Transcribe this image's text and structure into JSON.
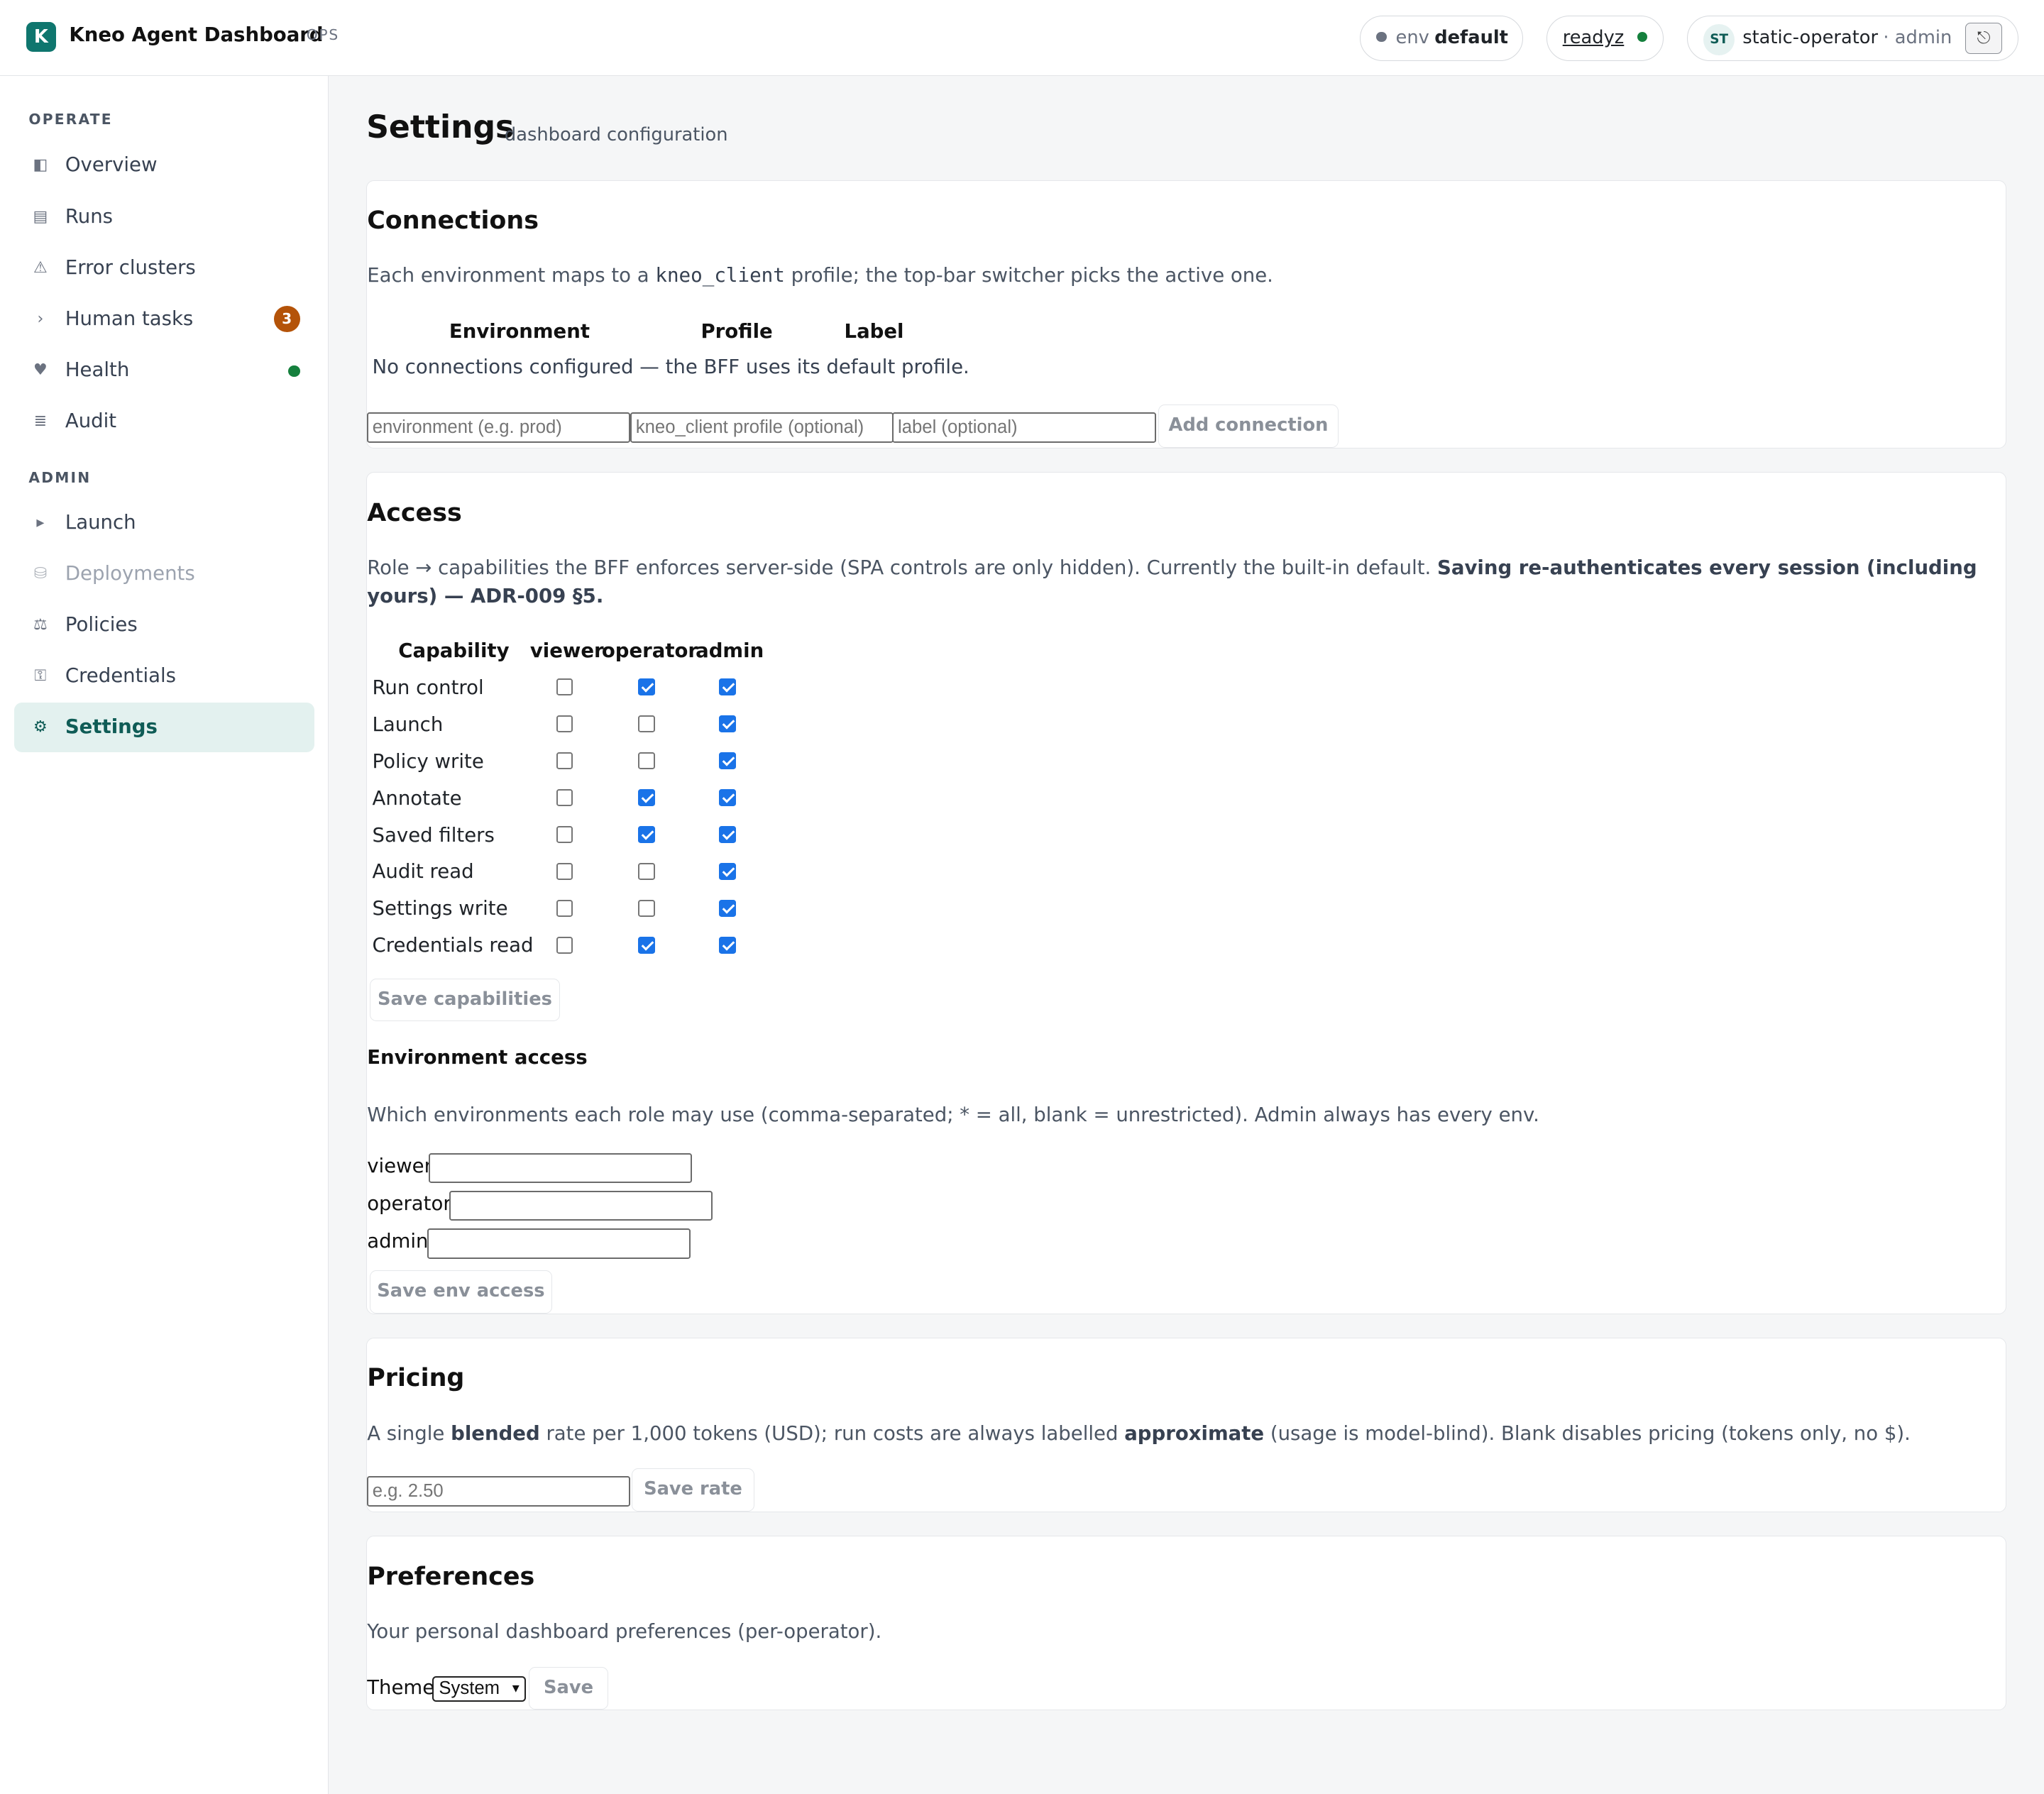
{
  "header": {
    "logo_letter": "K",
    "app_title": "Kneo Agent Dashboard",
    "app_tag": "OPS",
    "env_key": "env",
    "env_value": "default",
    "readyz_label": "readyz",
    "user_initials": "ST",
    "user_name": "static-operator",
    "user_role": "· admin",
    "logout_icon": "⎋"
  },
  "sidebar": {
    "operate_heading": "OPERATE",
    "admin_heading": "ADMIN",
    "operate_items": [
      {
        "label": "Overview",
        "icon": "◧",
        "icon_name": "overview-icon"
      },
      {
        "label": "Runs",
        "icon": "▤",
        "icon_name": "runs-icon"
      },
      {
        "label": "Error clusters",
        "icon": "⚠",
        "icon_name": "warning-icon"
      },
      {
        "label": "Human tasks",
        "icon": "›",
        "icon_name": "chevron-right-icon",
        "badge": "3"
      },
      {
        "label": "Health",
        "icon": "♥",
        "icon_name": "heart-icon",
        "status_color": "#15803d"
      },
      {
        "label": "Audit",
        "icon": "≣",
        "icon_name": "audit-icon"
      }
    ],
    "admin_items": [
      {
        "label": "Launch",
        "icon": "▸",
        "icon_name": "play-icon"
      },
      {
        "label": "Deployments",
        "icon": "⛁",
        "icon_name": "database-icon",
        "disabled": true
      },
      {
        "label": "Policies",
        "icon": "⚖",
        "icon_name": "scales-icon"
      },
      {
        "label": "Credentials",
        "icon": "⚿",
        "icon_name": "key-icon"
      },
      {
        "label": "Settings",
        "icon": "⚙",
        "icon_name": "gear-icon",
        "active": true
      }
    ]
  },
  "page": {
    "title": "Settings",
    "subtitle": "dashboard configuration"
  },
  "connections": {
    "title": "Connections",
    "desc_before": "Each environment maps to a ",
    "desc_code": "kneo_client",
    "desc_after": " profile; the top-bar switcher picks the active one.",
    "columns": [
      "Environment",
      "Profile",
      "Label"
    ],
    "empty_text": "No connections configured — the BFF uses its default profile.",
    "env_placeholder": "environment (e.g. prod)",
    "profile_placeholder": "kneo_client profile (optional)",
    "label_placeholder": "label (optional)",
    "add_button": "Add connection"
  },
  "access": {
    "title": "Access",
    "desc_plain": "Role → capabilities the BFF enforces server-side (SPA controls are only hidden). Currently the built-in default. ",
    "desc_bold": "Saving re-authenticates every session (including yours) — ADR-009 §5.",
    "columns": [
      "Capability",
      "viewer",
      "operator",
      "admin"
    ],
    "capabilities": [
      {
        "name": "Run control",
        "viewer": false,
        "operator": true,
        "admin": true
      },
      {
        "name": "Launch",
        "viewer": false,
        "operator": false,
        "admin": true
      },
      {
        "name": "Policy write",
        "viewer": false,
        "operator": false,
        "admin": true
      },
      {
        "name": "Annotate",
        "viewer": false,
        "operator": true,
        "admin": true
      },
      {
        "name": "Saved filters",
        "viewer": false,
        "operator": true,
        "admin": true
      },
      {
        "name": "Audit read",
        "viewer": false,
        "operator": false,
        "admin": true
      },
      {
        "name": "Settings write",
        "viewer": false,
        "operator": false,
        "admin": true
      },
      {
        "name": "Credentials read",
        "viewer": false,
        "operator": true,
        "admin": true
      }
    ],
    "save_capabilities": "Save capabilities",
    "env_access_title": "Environment access",
    "env_access_desc": "Which environments each role may use (comma-separated; * = all, blank = unrestricted). Admin always has every env.",
    "roles": [
      {
        "label": "viewer",
        "value": ""
      },
      {
        "label": "operator",
        "value": ""
      },
      {
        "label": "admin",
        "value": ""
      }
    ],
    "save_env_access": "Save env access"
  },
  "pricing": {
    "title": "Pricing",
    "desc_1": "A single ",
    "desc_b1": "blended",
    "desc_2": " rate per 1,000 tokens (USD); run costs are always labelled ",
    "desc_b2": "approximate",
    "desc_3": " (usage is model-blind). Blank disables pricing (tokens only, no $).",
    "rate_placeholder": "e.g. 2.50",
    "save_rate": "Save rate"
  },
  "preferences": {
    "title": "Preferences",
    "desc": "Your personal dashboard preferences (per-operator).",
    "theme_label": "Theme",
    "theme_value": "System",
    "save": "Save"
  },
  "colors": {
    "brand": "#0f766e",
    "active_nav_bg": "#e3f1ef",
    "badge": "#b45309",
    "status_ok": "#15803d",
    "checkbox_on": "#1a73e8"
  }
}
